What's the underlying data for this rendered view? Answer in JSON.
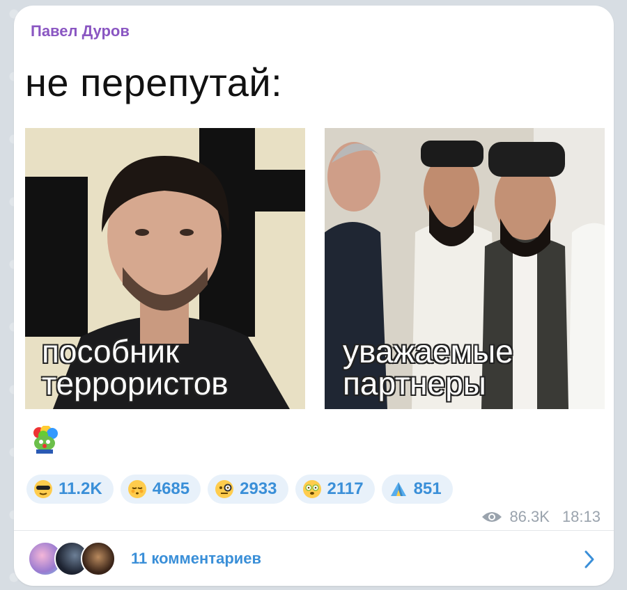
{
  "post": {
    "author": "Павел Дуров",
    "headline": "не перепутай:",
    "images": [
      {
        "caption_line1": "пособник",
        "caption_line2": "террористов"
      },
      {
        "caption_line1": "уважаемые",
        "caption_line2": "партнеры"
      }
    ],
    "sticker_icon": "clown-frog-icon"
  },
  "reactions": [
    {
      "icon": "cool-sunglasses-emoji",
      "count": "11.2K"
    },
    {
      "icon": "relieved-blush-emoji",
      "count": "4685"
    },
    {
      "icon": "monocle-face-emoji",
      "count": "2933"
    },
    {
      "icon": "dizzy-face-emoji",
      "count": "2117"
    },
    {
      "icon": "tent-emoji",
      "count": "851"
    }
  ],
  "meta": {
    "views": "86.3K",
    "time": "18:13"
  },
  "comments": {
    "label": "11 комментариев"
  },
  "colors": {
    "accent": "#3a8fd8",
    "author": "#8a56c2",
    "reaction_bg": "#e8f1fa"
  }
}
